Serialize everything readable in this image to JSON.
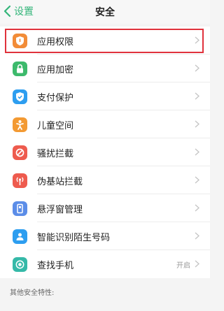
{
  "nav": {
    "back_label": "设置",
    "title": "安全"
  },
  "items": [
    {
      "label": "应用权限",
      "icon": "shield-icon",
      "color": "#f28c38"
    },
    {
      "label": "应用加密",
      "icon": "lock-icon",
      "color": "#3dba6c"
    },
    {
      "label": "支付保护",
      "icon": "shield-check-icon",
      "color": "#2d9ef0"
    },
    {
      "label": "儿童空间",
      "icon": "child-icon",
      "color": "#f39a33"
    },
    {
      "label": "骚扰拦截",
      "icon": "block-icon",
      "color": "#ee5b4e"
    },
    {
      "label": "伪基站拦截",
      "icon": "antenna-icon",
      "color": "#ee5b4e"
    },
    {
      "label": "悬浮窗管理",
      "icon": "floating-window-icon",
      "color": "#5b8de8"
    },
    {
      "label": "智能识别陌生号码",
      "icon": "contact-icon",
      "color": "#2d9ef0"
    },
    {
      "label": "查找手机",
      "icon": "locate-icon",
      "color": "#35b9a8",
      "value": "开启"
    }
  ],
  "footer": {
    "section_label": "其他安全特性:"
  },
  "colors": {
    "accent": "#34b57a",
    "highlight": "#e0323c"
  }
}
